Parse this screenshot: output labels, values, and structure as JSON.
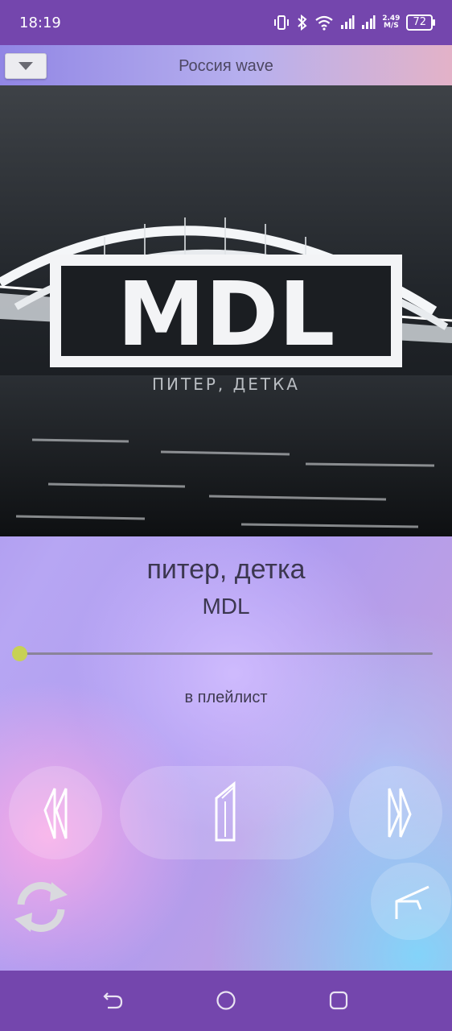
{
  "status_bar": {
    "time": "18:19",
    "speed_value": "2.49",
    "speed_unit": "M/S",
    "battery": "72"
  },
  "header": {
    "station_name": "Россия wave",
    "dropdown_icon": "triangle-down-icon"
  },
  "cover": {
    "logo_text": "MDL",
    "subtitle_text": "ПИТЕР, ДЕТКА"
  },
  "track": {
    "title": "питер, детка",
    "artist": "MDL",
    "progress": 0.0
  },
  "actions": {
    "playlist_label": "в плейлист"
  },
  "controls": {
    "prev_icon": "rewind-icon",
    "play_icon": "pause-icon",
    "next_icon": "fast-forward-icon",
    "repeat_icon": "repeat-icon",
    "share_icon": "share-icon"
  },
  "colors": {
    "status_bar": "#7446ad",
    "accent_seek": "#c7d154",
    "text": "#3c3750"
  },
  "nav_bar": {
    "back_icon": "back-icon",
    "home_icon": "home-icon",
    "recents_icon": "recents-icon"
  }
}
